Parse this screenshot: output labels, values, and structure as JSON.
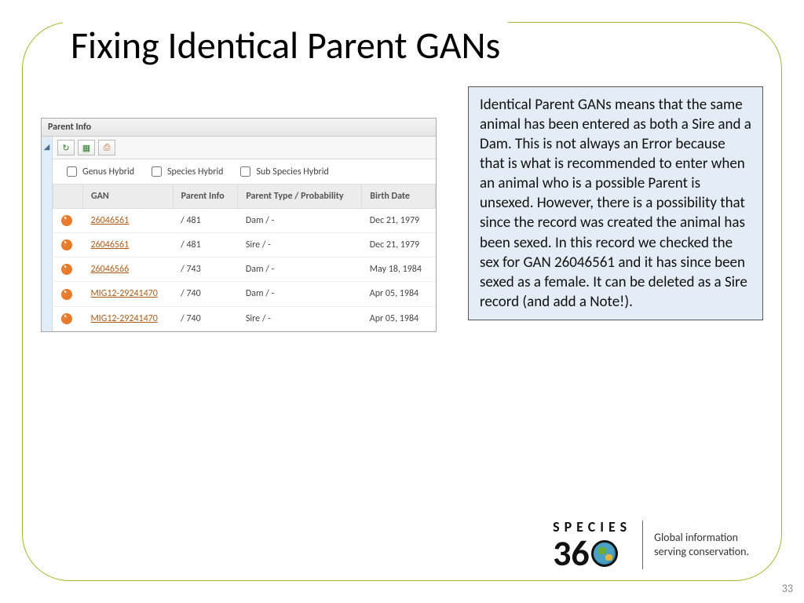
{
  "title": "Fixing Identical Parent GANs",
  "panel": {
    "header": "Parent Info",
    "hybrid": {
      "genus": "Genus Hybrid",
      "species": "Species Hybrid",
      "subspecies": "Sub Species Hybrid"
    },
    "columns": {
      "gan": "GAN",
      "parent_info": "Parent Info",
      "parent_type": "Parent Type / Probability",
      "birth_date": "Birth Date"
    },
    "rows": [
      {
        "gan": "26046561",
        "parent_info": "/ 481",
        "parent_type": "Dam / -",
        "birth_date": "Dec 21, 1979"
      },
      {
        "gan": "26046561",
        "parent_info": "/ 481",
        "parent_type": "Sire / -",
        "birth_date": "Dec 21, 1979"
      },
      {
        "gan": "26046566",
        "parent_info": "/ 743",
        "parent_type": "Dam / -",
        "birth_date": "May 18, 1984"
      },
      {
        "gan": "MIG12-29241470",
        "parent_info": "/ 740",
        "parent_type": "Dam / -",
        "birth_date": "Apr 05, 1984"
      },
      {
        "gan": "MIG12-29241470",
        "parent_info": "/ 740",
        "parent_type": "Sire / -",
        "birth_date": "Apr 05, 1984"
      }
    ]
  },
  "callout": "Identical Parent GANs means that the same animal has been entered as both a Sire and a Dam. This is not always an Error because that is what is recommended to enter when an animal who is a possible Parent is unsexed. However, there is a possibility that since the record was created the animal has been sexed. In this record we checked the sex for GAN 26046561 and it has since been sexed as a female. It can be deleted as a Sire record (and add a Note!).",
  "logo": {
    "species": "SPECIES",
    "three": "36",
    "zero_suffix": "",
    "tagline1": "Global information",
    "tagline2": "serving conservation."
  },
  "page_number": "33"
}
